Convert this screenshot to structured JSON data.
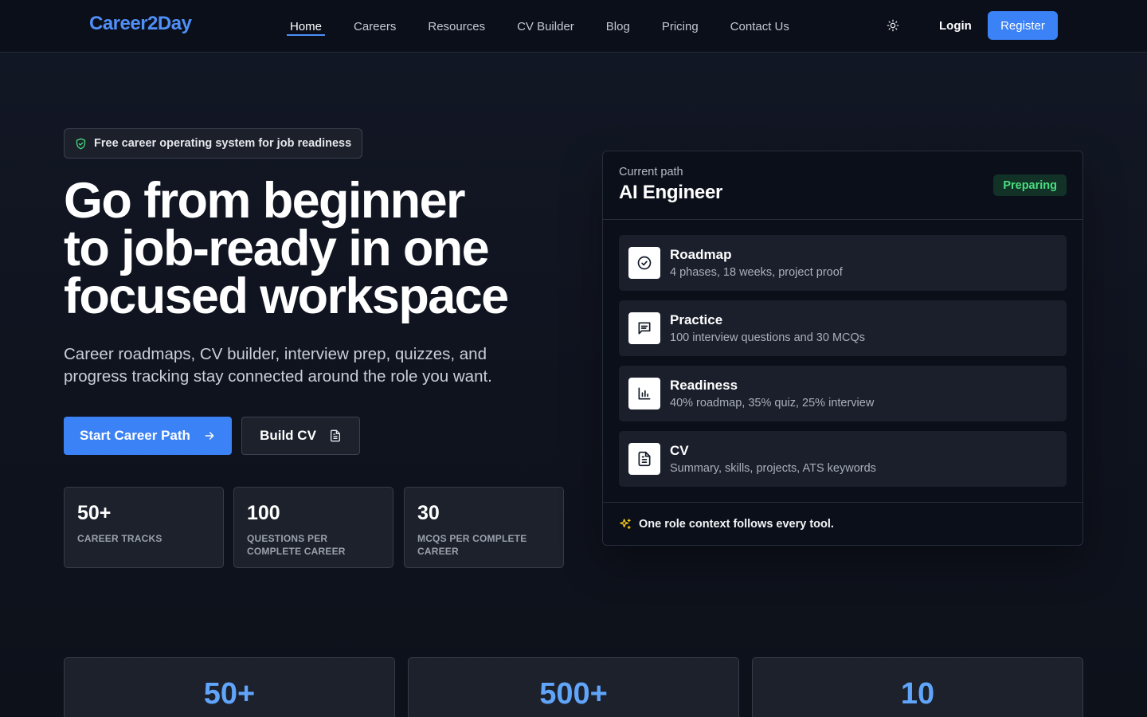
{
  "nav": {
    "logo": "Career2Day",
    "links": [
      "Home",
      "Careers",
      "Resources",
      "CV Builder",
      "Blog",
      "Pricing",
      "Contact Us"
    ],
    "active": "Home",
    "login": "Login",
    "register": "Register"
  },
  "hero": {
    "badge": "Free career operating system for job readiness",
    "title_lines": [
      "Go from beginner",
      "to job-ready in one",
      "focused workspace"
    ],
    "subtitle": "Career roadmaps, CV builder, interview prep, quizzes, and progress tracking stay connected around the role you want.",
    "primary_cta": "Start Career Path",
    "secondary_cta": "Build CV",
    "stats": [
      {
        "value": "50+",
        "label": "Career tracks"
      },
      {
        "value": "100",
        "label": "Questions per complete career"
      },
      {
        "value": "30",
        "label": "MCQs per complete career"
      }
    ]
  },
  "panel": {
    "kicker": "Current path",
    "title": "AI Engineer",
    "status": "Preparing",
    "features": [
      {
        "icon": "check-circle-icon",
        "title": "Roadmap",
        "desc": "4 phases, 18 weeks, project proof"
      },
      {
        "icon": "message-icon",
        "title": "Practice",
        "desc": "100 interview questions and 30 MCQs"
      },
      {
        "icon": "bar-chart-icon",
        "title": "Readiness",
        "desc": "40% roadmap, 35% quiz, 25% interview"
      },
      {
        "icon": "document-icon",
        "title": "CV",
        "desc": "Summary, skills, projects, ATS keywords"
      }
    ],
    "footer": "One role context follows every tool."
  },
  "bottom_stats": [
    "50+",
    "500+",
    "10"
  ],
  "colors": {
    "accent": "#3b82f6",
    "logo": "#4f8ff7",
    "status_green": "#4ade80",
    "stat_blue": "#60a5fa"
  }
}
